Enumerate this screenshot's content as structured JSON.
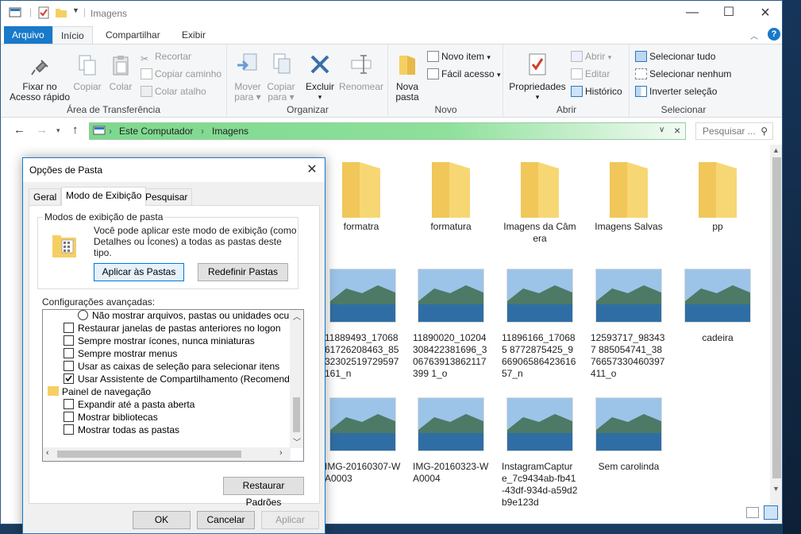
{
  "window": {
    "title": "Imagens"
  },
  "ribbon_tabs": [
    "Arquivo",
    "Início",
    "Compartilhar",
    "Exibir"
  ],
  "clipboard": {
    "pin": "Fixar no\nAcesso rápido",
    "pin_l1": "Fixar no",
    "pin_l2": "Acesso rápido",
    "copy": "Copiar",
    "paste": "Colar",
    "cut": "Recortar",
    "copy_path": "Copiar caminho",
    "paste_shortcut": "Colar atalho",
    "group": "Área de Transferência"
  },
  "organize": {
    "move_l1": "Mover",
    "move_l2": "para",
    "copy_l1": "Copiar",
    "copy_l2": "para",
    "delete": "Excluir",
    "rename": "Renomear",
    "group": "Organizar"
  },
  "new": {
    "folder_l1": "Nova",
    "folder_l2": "pasta",
    "new_item": "Novo item",
    "easy_access": "Fácil acesso",
    "group": "Novo"
  },
  "open": {
    "properties": "Propriedades",
    "open": "Abrir",
    "edit": "Editar",
    "history": "Histórico",
    "group": "Abrir"
  },
  "select": {
    "all": "Selecionar tudo",
    "none": "Selecionar nenhum",
    "invert": "Inverter seleção",
    "group": "Selecionar"
  },
  "address": {
    "crumbs": [
      "Este Computador",
      "Imagens"
    ]
  },
  "search": {
    "placeholder": "Pesquisar ..."
  },
  "items": [
    {
      "kind": "folder",
      "label": "formatra"
    },
    {
      "kind": "folder",
      "label": "formatura"
    },
    {
      "kind": "folder",
      "label": "Imagens da Câmera"
    },
    {
      "kind": "folder",
      "label": "Imagens Salvas"
    },
    {
      "kind": "folder",
      "label": "pp"
    },
    {
      "kind": "image",
      "label": "11889493_1706861726208463_8532302519729597161_n"
    },
    {
      "kind": "image",
      "label": "11890020_10204308422381696_306763913862117399 1_o"
    },
    {
      "kind": "image",
      "label": "11896166_170685 8772875425_96690658642361657_n"
    },
    {
      "kind": "image",
      "label": "12593717_983437 885054741_3876657330460397411_o"
    },
    {
      "kind": "image",
      "label": "cadeira"
    },
    {
      "kind": "image",
      "label": "IMG-20160307-WA0003"
    },
    {
      "kind": "image",
      "label": "IMG-20160323-WA0004"
    },
    {
      "kind": "image",
      "label": "InstagramCapture_7c9434ab-fb41-43df-934d-a59d2b9e123d"
    },
    {
      "kind": "image",
      "label": "Sem carolinda"
    }
  ],
  "tree_partial": "20",
  "dialog": {
    "title": "Opções de Pasta",
    "tabs": [
      "Geral",
      "Modo de Exibição",
      "Pesquisar"
    ],
    "views_group": "Modos de exibição de pasta",
    "views_desc_1": "Você pode aplicar este modo de exibição (como",
    "views_desc_2": "Detalhes ou Ícones) a todas as pastas deste tipo.",
    "apply_folders": "Aplicar às Pastas",
    "reset_folders": "Redefinir Pastas",
    "advanced_label": "Configurações avançadas:",
    "options": [
      {
        "type": "radio",
        "label": "Não mostrar arquivos, pastas ou unidades ocultas",
        "checked": false,
        "indent": 2
      },
      {
        "type": "check",
        "label": "Restaurar janelas de pastas anteriores no logon",
        "checked": false,
        "indent": 1
      },
      {
        "type": "check",
        "label": "Sempre mostrar ícones, nunca miniaturas",
        "checked": false,
        "indent": 1
      },
      {
        "type": "check",
        "label": "Sempre mostrar menus",
        "checked": false,
        "indent": 1
      },
      {
        "type": "check",
        "label": "Usar as caixas de seleção para selecionar itens",
        "checked": false,
        "indent": 1
      },
      {
        "type": "check",
        "label": "Usar Assistente de Compartilhamento (Recomendado)",
        "checked": true,
        "indent": 1
      },
      {
        "type": "group",
        "label": "Painel de navegação",
        "checked": false,
        "indent": 0
      },
      {
        "type": "check",
        "label": "Expandir até a pasta aberta",
        "checked": false,
        "indent": 1
      },
      {
        "type": "check",
        "label": "Mostrar bibliotecas",
        "checked": false,
        "indent": 1
      },
      {
        "type": "check",
        "label": "Mostrar todas as pastas",
        "checked": false,
        "indent": 1
      }
    ],
    "restore_defaults": "Restaurar Padrões",
    "ok": "OK",
    "cancel": "Cancelar",
    "apply": "Aplicar"
  },
  "colors": {
    "accent": "#1979ca",
    "folder": "#f5cf62",
    "address_highlight": "#7dd88e"
  }
}
